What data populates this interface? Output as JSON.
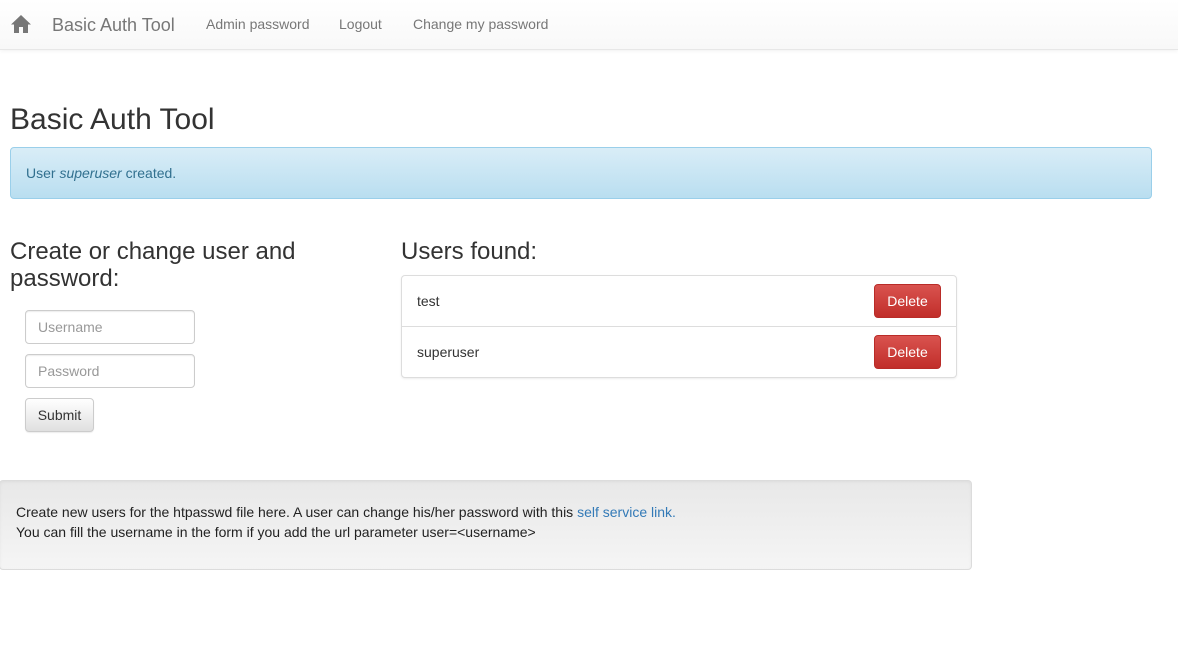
{
  "navbar": {
    "home_icon": "home-icon",
    "brand": "Basic Auth Tool",
    "links": [
      {
        "label": "Admin password"
      },
      {
        "label": "Logout"
      },
      {
        "label": "Change my password"
      }
    ]
  },
  "page": {
    "title": "Basic Auth Tool"
  },
  "alert": {
    "prefix": "User ",
    "username": "superuser",
    "suffix": " created."
  },
  "form": {
    "heading": "Create or change user and password:",
    "username_placeholder": "Username",
    "username_value": "",
    "password_placeholder": "Password",
    "password_value": "",
    "submit_label": "Submit"
  },
  "users": {
    "heading": "Users found:",
    "items": [
      {
        "name": "test",
        "delete_label": "Delete"
      },
      {
        "name": "superuser",
        "delete_label": "Delete"
      }
    ]
  },
  "info": {
    "line1_text": "Create new users for the htpasswd file here. A user can change his/her password with this ",
    "line1_link": "self service link.",
    "line2_text": "You can fill the username in the form if you add the url parameter user=<username>"
  },
  "colors": {
    "danger": "#d9534f",
    "info_bg": "#d9edf7",
    "info_text": "#31708f",
    "link": "#337ab7"
  }
}
